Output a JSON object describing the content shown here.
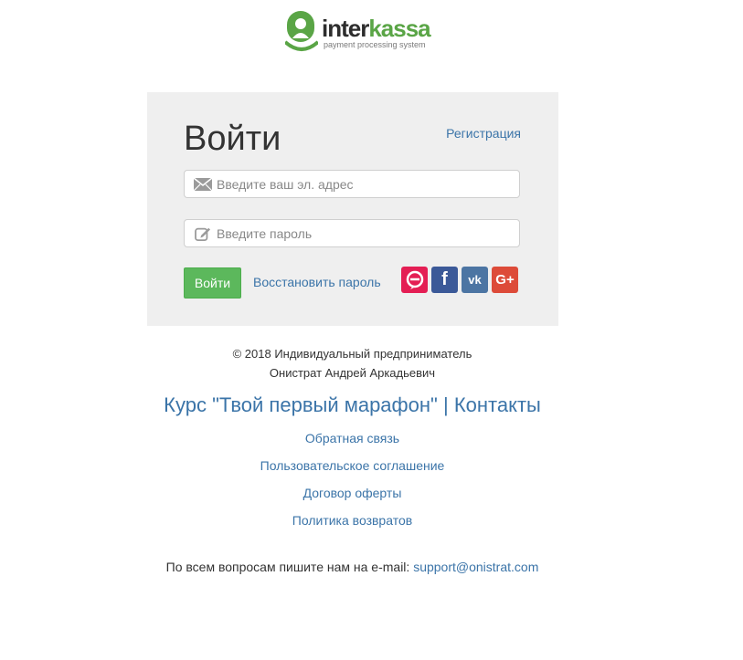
{
  "logo": {
    "brand_part1": "inter",
    "brand_part2": "kassa",
    "tagline": "payment processing system",
    "icon": "person-badge-icon"
  },
  "login": {
    "title": "Войти",
    "register_link": "Регистрация",
    "email_placeholder": "Введите ваш эл. адрес",
    "password_placeholder": "Введите пароль",
    "submit_label": "Войти",
    "restore_link": "Восстановить пароль",
    "social": [
      {
        "name": "chat-bubble-icon",
        "glyph": "",
        "color": "#e41e54"
      },
      {
        "name": "facebook-icon",
        "glyph": "f",
        "color": "#3b5998"
      },
      {
        "name": "vk-icon",
        "glyph": "vk",
        "color": "#4c75a3"
      },
      {
        "name": "google-plus-icon",
        "glyph": "G+",
        "color": "#dd4b39"
      }
    ]
  },
  "footer": {
    "copyright_line1": "© 2018 Индивидуальный предприниматель",
    "copyright_line2": "Онистрат Андрей Аркадьевич",
    "course_link": "Курс \"Твой первый марафон\"",
    "separator": "|",
    "contacts_link": "Контакты",
    "links": [
      "Обратная связь",
      "Пользовательское соглашение",
      "Договор оферты",
      "Политика возвратов"
    ],
    "contact_text": "По всем вопросам пишите нам на e-mail: ",
    "contact_email": "support@onistrat.com"
  },
  "colors": {
    "accent_link": "#3b74a8",
    "button_green": "#5cb85c",
    "panel_bg": "#efefef",
    "brand_green": "#5aa546"
  }
}
